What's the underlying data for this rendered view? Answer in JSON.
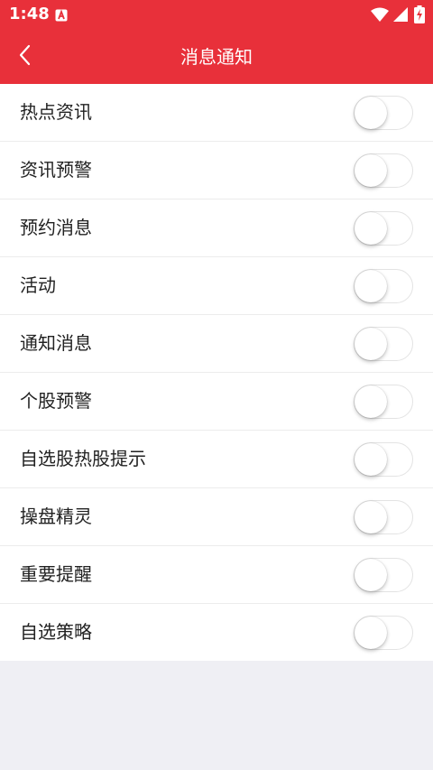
{
  "status_bar": {
    "time": "1:48",
    "notification_icon": "a-letter-icon",
    "icons": [
      "wifi-icon",
      "signal-icon",
      "battery-charging-icon"
    ]
  },
  "header": {
    "back_icon": "chevron-left-icon",
    "title": "消息通知",
    "color": "#e8303a"
  },
  "settings": {
    "items": [
      {
        "label": "热点资讯",
        "enabled": false
      },
      {
        "label": "资讯预警",
        "enabled": false
      },
      {
        "label": "预约消息",
        "enabled": false
      },
      {
        "label": "活动",
        "enabled": false
      },
      {
        "label": "通知消息",
        "enabled": false
      },
      {
        "label": "个股预警",
        "enabled": false
      },
      {
        "label": "自选股热股提示",
        "enabled": false
      },
      {
        "label": "操盘精灵",
        "enabled": false
      },
      {
        "label": "重要提醒",
        "enabled": false
      },
      {
        "label": "自选策略",
        "enabled": false
      }
    ]
  }
}
